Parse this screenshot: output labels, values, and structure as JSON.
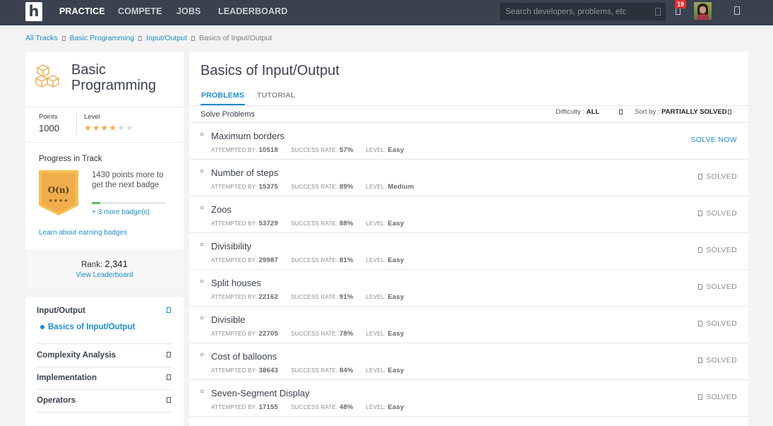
{
  "nav": {
    "logo": "h",
    "links": [
      "PRACTICE",
      "COMPETE",
      "JOBS",
      "LEADERBOARD"
    ],
    "search_placeholder": "Search developers, problems, etc",
    "notifications": "19"
  },
  "breadcrumb": [
    "All Tracks",
    "Basic Programming",
    "Input/Output",
    "Basics of Input/Output"
  ],
  "track": {
    "title": "Basic Programming",
    "points_label": "Points",
    "points_value": "1000",
    "level_label": "Level",
    "level_stars": 4,
    "level_max": 6,
    "progress_title": "Progress in Track",
    "badge_label": "O(n)",
    "badge_text": "1430 points more to get the next badge",
    "badge_progress": 0.12,
    "more_badges": "+ 3 more badge(s)",
    "learn_link": "Learn about earning badges",
    "rank_label": "Rank:",
    "rank_value": "2,341",
    "view_leaderboard": "View Leaderboard"
  },
  "left_nav": {
    "sections": [
      "Input/Output",
      "Complexity Analysis",
      "Implementation",
      "Operators"
    ],
    "active_sub": "Basics of Input/Output"
  },
  "main": {
    "title": "Basics of Input/Output",
    "tabs": [
      "PROBLEMS",
      "TUTORIAL"
    ],
    "solve_label": "Solve Problems",
    "difficulty_label": "Difficulty :",
    "difficulty_value": "ALL",
    "sort_label": "Sort by :",
    "sort_value": "PARTIALLY SOLVED",
    "attempted_label": "ATTEMPTED BY:",
    "success_label": "SUCCESS RATE:",
    "level_label": "LEVEL:",
    "problems": [
      {
        "name": "Maximum borders",
        "attempted": "10518",
        "success": "57%",
        "level": "Easy",
        "status": "SOLVE NOW"
      },
      {
        "name": "Number of steps",
        "attempted": "15375",
        "success": "89%",
        "level": "Medium",
        "status": "SOLVED"
      },
      {
        "name": "Zoos",
        "attempted": "53729",
        "success": "88%",
        "level": "Easy",
        "status": "SOLVED"
      },
      {
        "name": "Divisibility",
        "attempted": "29987",
        "success": "81%",
        "level": "Easy",
        "status": "SOLVED"
      },
      {
        "name": "Split houses",
        "attempted": "22162",
        "success": "91%",
        "level": "Easy",
        "status": "SOLVED"
      },
      {
        "name": "Divisible",
        "attempted": "22705",
        "success": "78%",
        "level": "Easy",
        "status": "SOLVED"
      },
      {
        "name": "Cost of balloons",
        "attempted": "38643",
        "success": "84%",
        "level": "Easy",
        "status": "SOLVED"
      },
      {
        "name": "Seven-Segment Display",
        "attempted": "17155",
        "success": "48%",
        "level": "Easy",
        "status": "SOLVED"
      }
    ]
  },
  "colors": {
    "nav_bg": "#39424e",
    "accent": "#1a8ccc",
    "badge": "#f0ad4e"
  }
}
